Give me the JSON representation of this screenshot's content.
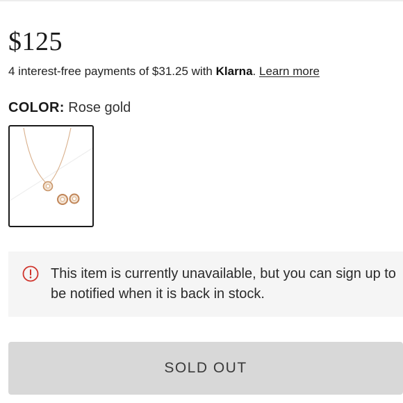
{
  "product": {
    "price": "$125",
    "installments": {
      "text_before": "4 interest-free payments of $31.25 with ",
      "provider": "Klarna",
      "separator": ".",
      "learn_more": "Learn more"
    },
    "color": {
      "label": "COLOR:",
      "value": "Rose gold",
      "swatch_icon": "necklace-earrings-swatch"
    },
    "notice": {
      "icon": "alert-circle-icon",
      "message": "This item is currently unavailable, but you can sign up to be notified when it is back in stock."
    },
    "cta": {
      "label": "SOLD OUT"
    }
  },
  "colors": {
    "text": "#1a1a1a",
    "alert_red": "#d0342c",
    "notice_bg": "#f5f5f5",
    "button_bg": "#d8d8d8",
    "rose_gold": "#d4a373"
  }
}
